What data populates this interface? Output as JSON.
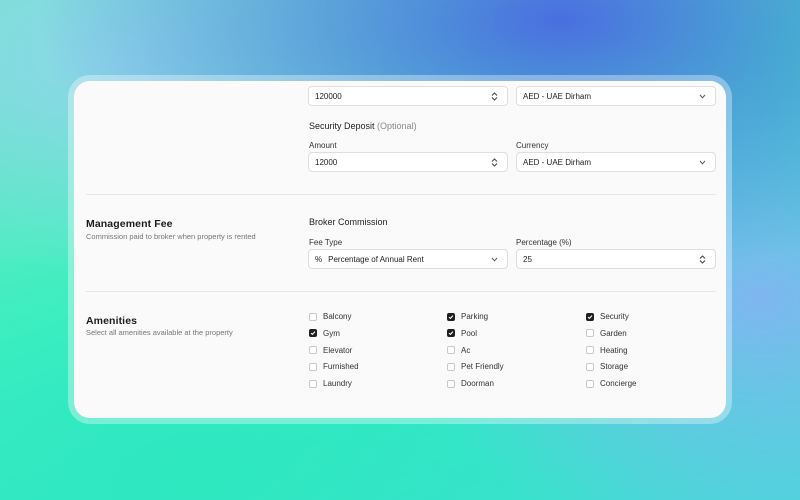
{
  "rent": {
    "amount_value": "120000",
    "currency_value": "AED - UAE Dirham"
  },
  "security_deposit": {
    "title": "Security Deposit",
    "optional": "(Optional)",
    "amount_label": "Amount",
    "amount_value": "12000",
    "currency_label": "Currency",
    "currency_value": "AED - UAE Dirham"
  },
  "management_fee": {
    "title": "Management Fee",
    "description": "Commission paid to broker when property is rented",
    "broker_commission_title": "Broker Commission",
    "fee_type_label": "Fee Type",
    "fee_type_symbol": "%",
    "fee_type_value": "Percentage of Annual Rent",
    "percentage_label": "Percentage (%)",
    "percentage_value": "25"
  },
  "amenities": {
    "title": "Amenities",
    "description": "Select all amenities available at the property",
    "items": [
      {
        "label": "Balcony",
        "checked": false
      },
      {
        "label": "Parking",
        "checked": true
      },
      {
        "label": "Security",
        "checked": true
      },
      {
        "label": "Gym",
        "checked": true
      },
      {
        "label": "Pool",
        "checked": true
      },
      {
        "label": "Garden",
        "checked": false
      },
      {
        "label": "Elevator",
        "checked": false
      },
      {
        "label": "Ac",
        "checked": false
      },
      {
        "label": "Heating",
        "checked": false
      },
      {
        "label": "Furnished",
        "checked": false
      },
      {
        "label": "Pet Friendly",
        "checked": false
      },
      {
        "label": "Storage",
        "checked": false
      },
      {
        "label": "Laundry",
        "checked": false
      },
      {
        "label": "Doorman",
        "checked": false
      },
      {
        "label": "Concierge",
        "checked": false
      }
    ]
  },
  "icons": {
    "stepper": "stepper-icon",
    "chevron": "chevron-down-icon",
    "check": "check-icon"
  },
  "colors": {
    "checked": "#1f1f1f",
    "card": "#fafafa"
  }
}
